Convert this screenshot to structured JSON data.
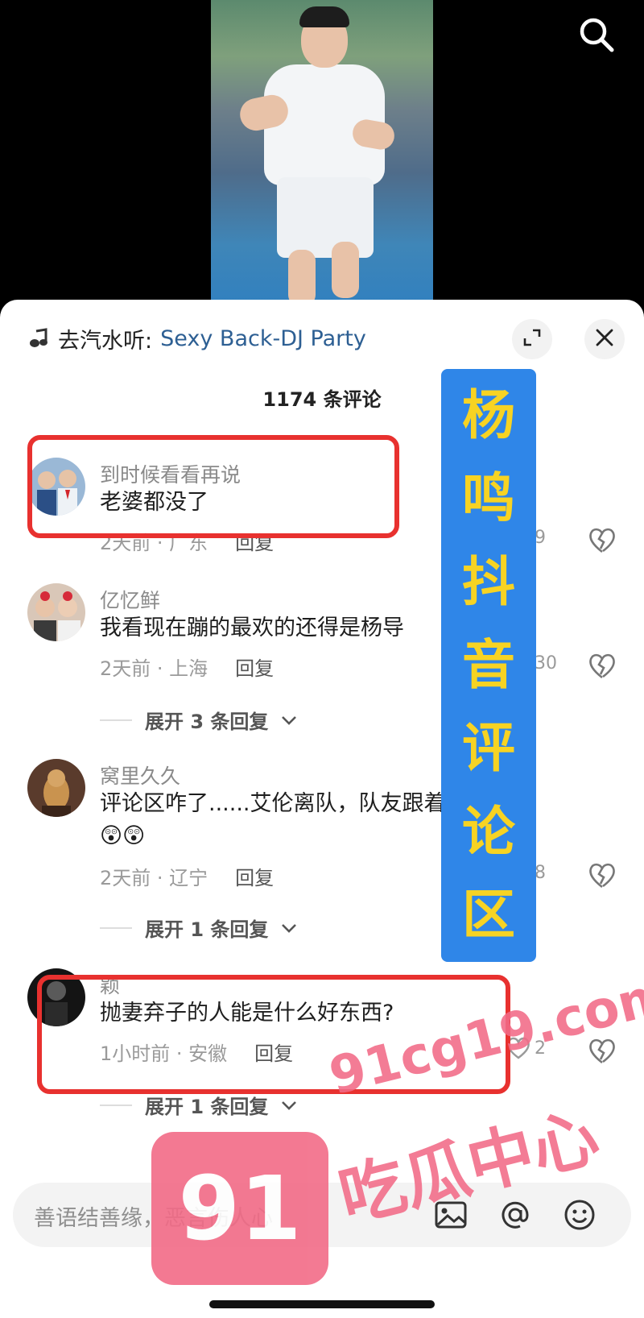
{
  "music": {
    "label": "去汽水听:",
    "song": "Sexy Back-DJ Party"
  },
  "comments_title": "1174 条评论",
  "comments": [
    {
      "name": "到时候看看再说",
      "text": "老婆都没了",
      "time": "2天前 · 广东",
      "reply": "回复",
      "likes": "9"
    },
    {
      "name": "亿忆鲜",
      "text": "我看现在蹦的最欢的还得是杨导",
      "time": "2天前 · 上海",
      "reply": "回复",
      "likes": "30",
      "expand": "展开 3 条回复"
    },
    {
      "name": "窝里久久",
      "text": "评论区咋了......艾伦离队，队友跟着挨骂😲",
      "text2": "😲😲",
      "time": "2天前 · 辽宁",
      "reply": "回复",
      "likes": "8",
      "expand": "展开 1 条回复"
    },
    {
      "name": "颖",
      "text": "抛妻弃子的人能是什么好东西?",
      "time": "1小时前 · 安徽",
      "reply": "回复",
      "likes": "2",
      "expand": "展开 1 条回复"
    }
  ],
  "banner_chars": [
    "杨",
    "鸣",
    "抖",
    "音",
    "评",
    "论",
    "区"
  ],
  "input": {
    "placeholder": "善语结善缘，恶言伤人心"
  },
  "watermark": {
    "badge": "91",
    "url": "91cg19.com",
    "name": "吃瓜中心"
  },
  "colors": {
    "highlight_box": "#e8312f",
    "banner_bg": "#2f86e8",
    "banner_text": "#f7d323",
    "link": "#2d5f93",
    "watermark": "#f26b87"
  },
  "icons": [
    "search-icon",
    "music-note-icon",
    "expand-icon",
    "close-icon",
    "heart-icon",
    "broken-heart-icon",
    "image-icon",
    "at-icon",
    "emoji-icon"
  ]
}
